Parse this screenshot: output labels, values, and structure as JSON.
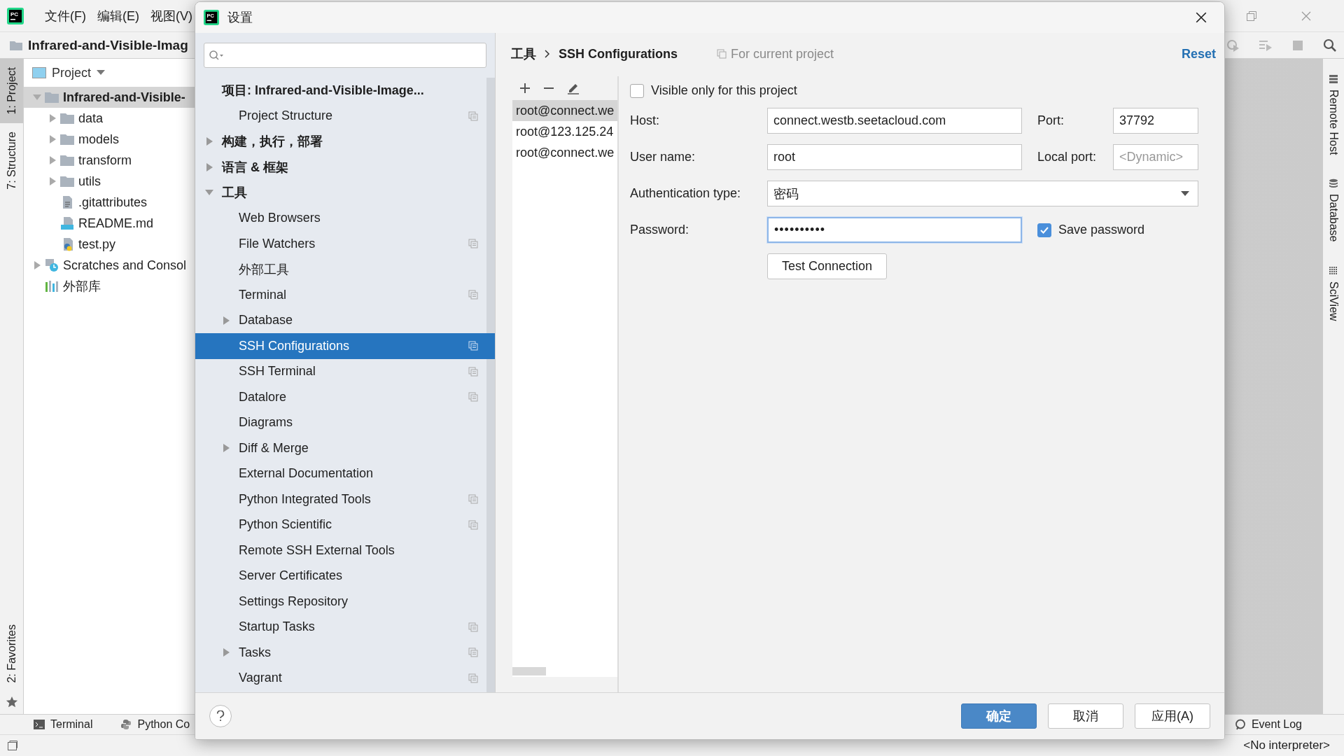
{
  "ide": {
    "logo_text": "PC",
    "menu": [
      "文件(F)",
      "编辑(E)",
      "视图(V)"
    ],
    "nav_path": "Infrared-and-Visible-Imag",
    "left_stripes": [
      {
        "label": "1: Project",
        "selected": true
      },
      {
        "label": "7: Structure",
        "selected": false
      }
    ],
    "left_bottom_stripes": [
      {
        "label": "2: Favorites",
        "selected": false
      }
    ],
    "right_stripes": [
      {
        "label": "Remote Host",
        "kind": "server"
      },
      {
        "label": "Database",
        "kind": "database"
      },
      {
        "label": "SciView",
        "kind": "grid"
      }
    ],
    "project_panel": {
      "title": "Project",
      "tree": [
        {
          "label": "Infrared-and-Visible-",
          "kind": "project",
          "expanded": true,
          "selected": true,
          "children": [
            {
              "label": "data",
              "kind": "folder",
              "expanded": false,
              "selected": false
            },
            {
              "label": "models",
              "kind": "folder",
              "expanded": false,
              "selected": false
            },
            {
              "label": "transform",
              "kind": "folder",
              "expanded": false,
              "selected": false
            },
            {
              "label": "utils",
              "kind": "folder",
              "expanded": false,
              "selected": false
            },
            {
              "label": ".gitattributes",
              "kind": "text",
              "selected": false
            },
            {
              "label": "README.md",
              "kind": "markdown",
              "selected": false
            },
            {
              "label": "test.py",
              "kind": "python",
              "selected": false
            }
          ]
        },
        {
          "label": "Scratches and Consol",
          "kind": "scratches",
          "expanded": false,
          "selected": false
        },
        {
          "label": "外部库",
          "kind": "library",
          "selected": false
        }
      ]
    },
    "bottom_tools": [
      {
        "label": "Terminal",
        "kind": "terminal"
      },
      {
        "label": "Python Co",
        "kind": "python"
      }
    ],
    "event_log": "Event Log",
    "status_interpreter": "<No interpreter>"
  },
  "dialog": {
    "logo_text": "PC",
    "title": "设置",
    "settings_tree": [
      {
        "label": "项目: Infrared-and-Visible-Image...",
        "selected": false,
        "project_scoped": false,
        "children": [
          {
            "label": "Project Structure",
            "selected": false,
            "project_scoped": true
          }
        ]
      },
      {
        "label": "构建，执行，部署",
        "expanded": false,
        "selected": false,
        "project_scoped": false
      },
      {
        "label": "语言 & 框架",
        "expanded": false,
        "selected": false,
        "project_scoped": false
      },
      {
        "label": "工具",
        "expanded": true,
        "selected": false,
        "project_scoped": false,
        "children": [
          {
            "label": "Web Browsers",
            "selected": false,
            "project_scoped": false
          },
          {
            "label": "File Watchers",
            "selected": false,
            "project_scoped": true
          },
          {
            "label": "外部工具",
            "selected": false,
            "project_scoped": false
          },
          {
            "label": "Terminal",
            "selected": false,
            "project_scoped": true
          },
          {
            "label": "Database",
            "expanded": false,
            "selected": false,
            "project_scoped": false
          },
          {
            "label": "SSH Configurations",
            "selected": true,
            "project_scoped": true
          },
          {
            "label": "SSH Terminal",
            "selected": false,
            "project_scoped": true
          },
          {
            "label": "Datalore",
            "selected": false,
            "project_scoped": true
          },
          {
            "label": "Diagrams",
            "selected": false,
            "project_scoped": false
          },
          {
            "label": "Diff & Merge",
            "expanded": false,
            "selected": false,
            "project_scoped": false
          },
          {
            "label": "External Documentation",
            "selected": false,
            "project_scoped": false
          },
          {
            "label": "Python Integrated Tools",
            "selected": false,
            "project_scoped": true
          },
          {
            "label": "Python Scientific",
            "selected": false,
            "project_scoped": true
          },
          {
            "label": "Remote SSH External Tools",
            "selected": false,
            "project_scoped": false
          },
          {
            "label": "Server Certificates",
            "selected": false,
            "project_scoped": false
          },
          {
            "label": "Settings Repository",
            "selected": false,
            "project_scoped": false
          },
          {
            "label": "Startup Tasks",
            "selected": false,
            "project_scoped": true
          },
          {
            "label": "Tasks",
            "expanded": false,
            "selected": false,
            "project_scoped": true
          },
          {
            "label": "Vagrant",
            "selected": false,
            "project_scoped": true
          }
        ]
      }
    ],
    "breadcrumb": [
      "工具",
      "SSH Configurations"
    ],
    "scope_note": "For current project",
    "reset": "Reset",
    "ssh_list": [
      {
        "label": "root@connect.we",
        "selected": true
      },
      {
        "label": "root@123.125.24",
        "selected": false
      },
      {
        "label": "root@connect.we",
        "selected": false
      }
    ],
    "visible_only": {
      "label": "Visible only for this project",
      "checked": false
    },
    "host": {
      "label": "Host:",
      "value": "connect.westb.seetacloud.com"
    },
    "port": {
      "label": "Port:",
      "value": "37792"
    },
    "user": {
      "label": "User name:",
      "value": "root"
    },
    "local_port": {
      "label": "Local port:",
      "placeholder": "<Dynamic>"
    },
    "auth": {
      "label": "Authentication type:",
      "value": "密码"
    },
    "password": {
      "label": "Password:",
      "value": "••••••••••",
      "focused": true
    },
    "save_password": {
      "label": "Save password",
      "checked": true
    },
    "test_button": "Test Connection",
    "buttons": [
      {
        "label": "确定",
        "kind": "primary"
      },
      {
        "label": "取消",
        "kind": "default"
      },
      {
        "label": "应用(A)",
        "kind": "default"
      }
    ]
  }
}
